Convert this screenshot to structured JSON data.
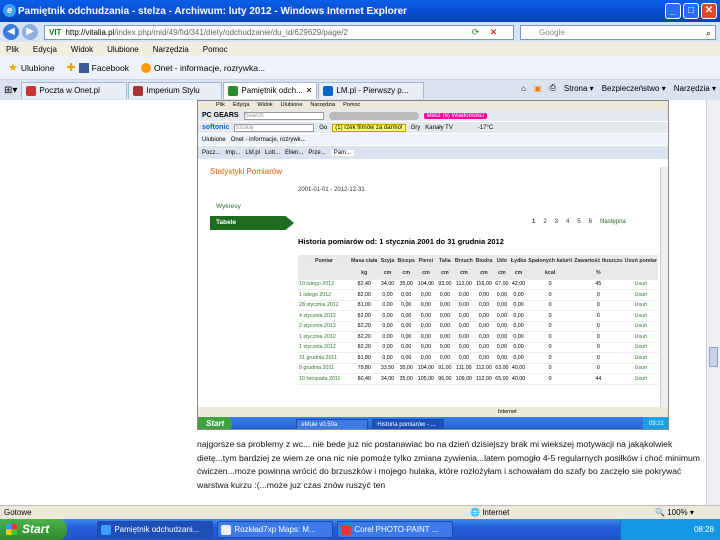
{
  "window": {
    "title": "Pamiętnik odchudzania - stelza - Archiwum: luty 2012 - Windows Internet Explorer",
    "controls": [
      "_",
      "□",
      "✕"
    ]
  },
  "address": {
    "host": "http://vitalia.pl",
    "path": "/index.php/mid/49/fid/341/diety/odchudzanie/du_id/629629/page/2",
    "search_placeholder": "Google"
  },
  "menu": [
    "Plik",
    "Edycja",
    "Widok",
    "Ulubione",
    "Narzędzia",
    "Pomoc"
  ],
  "favorites": {
    "label": "Ulubione",
    "items": [
      "Facebook",
      "Onet - informacje, rozrywka..."
    ]
  },
  "tabs": [
    "Poczta w Onet.pl",
    "Imperium Stylu",
    "Pamiętnik odch...",
    "LM.pl - Pierwszy p..."
  ],
  "command_bar": [
    "Strona ▾",
    "Bezpieczeństwo ▾",
    "Narzędzia ▾"
  ],
  "shot": {
    "menu": [
      "Plik",
      "Edycja",
      "Widok",
      "Ulubione",
      "Narzędzia",
      "Pomoc"
    ],
    "bar1": {
      "logo": "PC GEARS",
      "search": "Search",
      "pink": "Masz (6) Wiadomości"
    },
    "bar2": {
      "logo": "softonic",
      "search": "Szukaj",
      "go": "Go",
      "ad": "(1) rzek filmów za darmo!",
      "games": "Gry",
      "tv": "Kanały TV",
      "temp": "-17°C"
    },
    "favbar": [
      "Ulubione",
      "Onet - informacje, rozrywk..."
    ],
    "tabs": [
      "Pocz...",
      "Imp...",
      "LM.pl",
      "Lott...",
      "Ellen...",
      "Prze...",
      "Pam..."
    ],
    "section": "Statystyki Pomiarów",
    "date_range": "2001-01-01 - 2012-12-31",
    "side_a": "Wykresy",
    "side_b": "Tabele",
    "pages": [
      "1",
      "2",
      "3",
      "4",
      "5",
      "6"
    ],
    "next": "Następna",
    "history_title": "Historia pomiarów od: 1 stycznia 2001 do 31 grudnia 2012",
    "table_head": [
      "Pomiar",
      "Masa ciała",
      "Szyja",
      "Biceps",
      "Piersi",
      "Talia",
      "Brzuch",
      "Biodra",
      "Udo",
      "Łydka",
      "Spalonych kalorii",
      "Zawartość tłuszczu",
      "Usuń pomiar"
    ],
    "table_units": [
      "",
      "kg",
      "cm",
      "cm",
      "cm",
      "cm",
      "cm",
      "cm",
      "cm",
      "cm",
      "kcal",
      "%",
      ""
    ],
    "rows": [
      [
        "10 lutego 2012",
        "82,40",
        "34,00",
        "35,00",
        "104,00",
        "93,00",
        "112,00",
        "116,00",
        "67,00",
        "42,00",
        "0",
        "45",
        "Usuń"
      ],
      [
        "1 lutego 2012",
        "82,00",
        "0,00",
        "0,00",
        "0,00",
        "0,00",
        "0,00",
        "0,00",
        "0,00",
        "0,00",
        "0",
        "0",
        "Usuń"
      ],
      [
        "28 stycznia 2012",
        "81,00",
        "0,00",
        "0,00",
        "0,00",
        "0,00",
        "0,00",
        "0,00",
        "0,00",
        "0,00",
        "0",
        "0",
        "Usuń"
      ],
      [
        "4 stycznia 2012",
        "82,00",
        "0,00",
        "0,00",
        "0,00",
        "0,00",
        "0,00",
        "0,00",
        "0,00",
        "0,00",
        "0",
        "0",
        "Usuń"
      ],
      [
        "2 stycznia 2012",
        "82,20",
        "0,00",
        "0,00",
        "0,00",
        "0,00",
        "0,00",
        "0,00",
        "0,00",
        "0,00",
        "0",
        "0",
        "Usuń"
      ],
      [
        "1 stycznia 2012",
        "82,20",
        "0,00",
        "0,00",
        "0,00",
        "0,00",
        "0,00",
        "0,00",
        "0,00",
        "0,00",
        "0",
        "0",
        "Usuń"
      ],
      [
        "1 stycznia 2012",
        "82,20",
        "0,00",
        "0,00",
        "0,00",
        "0,00",
        "0,00",
        "0,00",
        "0,00",
        "0,00",
        "0",
        "0",
        "Usuń"
      ],
      [
        "31 grudnia 2011",
        "81,80",
        "0,00",
        "0,00",
        "0,00",
        "0,00",
        "0,00",
        "0,00",
        "0,00",
        "0,00",
        "0",
        "0",
        "Usuń"
      ],
      [
        "9 grudnia 2011",
        "79,80",
        "33,50",
        "35,00",
        "104,00",
        "91,00",
        "111,00",
        "112,00",
        "63,00",
        "40,00",
        "0",
        "0",
        "Usuń"
      ],
      [
        "10 listopada 2011",
        "80,40",
        "34,00",
        "35,00",
        "105,00",
        "96,00",
        "109,00",
        "112,00",
        "65,00",
        "40,00",
        "0",
        "44",
        "Usuń"
      ]
    ],
    "status": "Internet",
    "taskbar": {
      "start": "Start",
      "items": [
        "eMule v0.50a",
        "Historia pomiarów - ..."
      ],
      "clock": "09:21"
    }
  },
  "paragraph": "najgorsze sa problemy z wc... nie bede juz nic postanawiac bo na dzień dzisiejszy brak mi wiekszej motywacji na jakąkolwiek dietę...tym bardziej  ze wiem ze ona nic nie pomoże  tylko zmiana zywienia...latem pomogło 4-5 regularnych posiłków i choć minimum ćwiczen...moze powinna wrócić do brzuszków i mojego hulaka, które rozłożyłam i schowałam do szafy bo zaczęło sie pokrywać warstwa kurzu :(...może juz czas znów ruszyć ten",
  "statusbar": {
    "left": "Gotowe",
    "zone": "Internet",
    "zoom": "100%"
  },
  "taskbar": {
    "start": "Start",
    "items": [
      "Pamiętnik odchudzani...",
      "Rozkład7xp Maps: M...",
      "Corel PHOTO-PAINT ..."
    ],
    "clock": "08:28"
  }
}
